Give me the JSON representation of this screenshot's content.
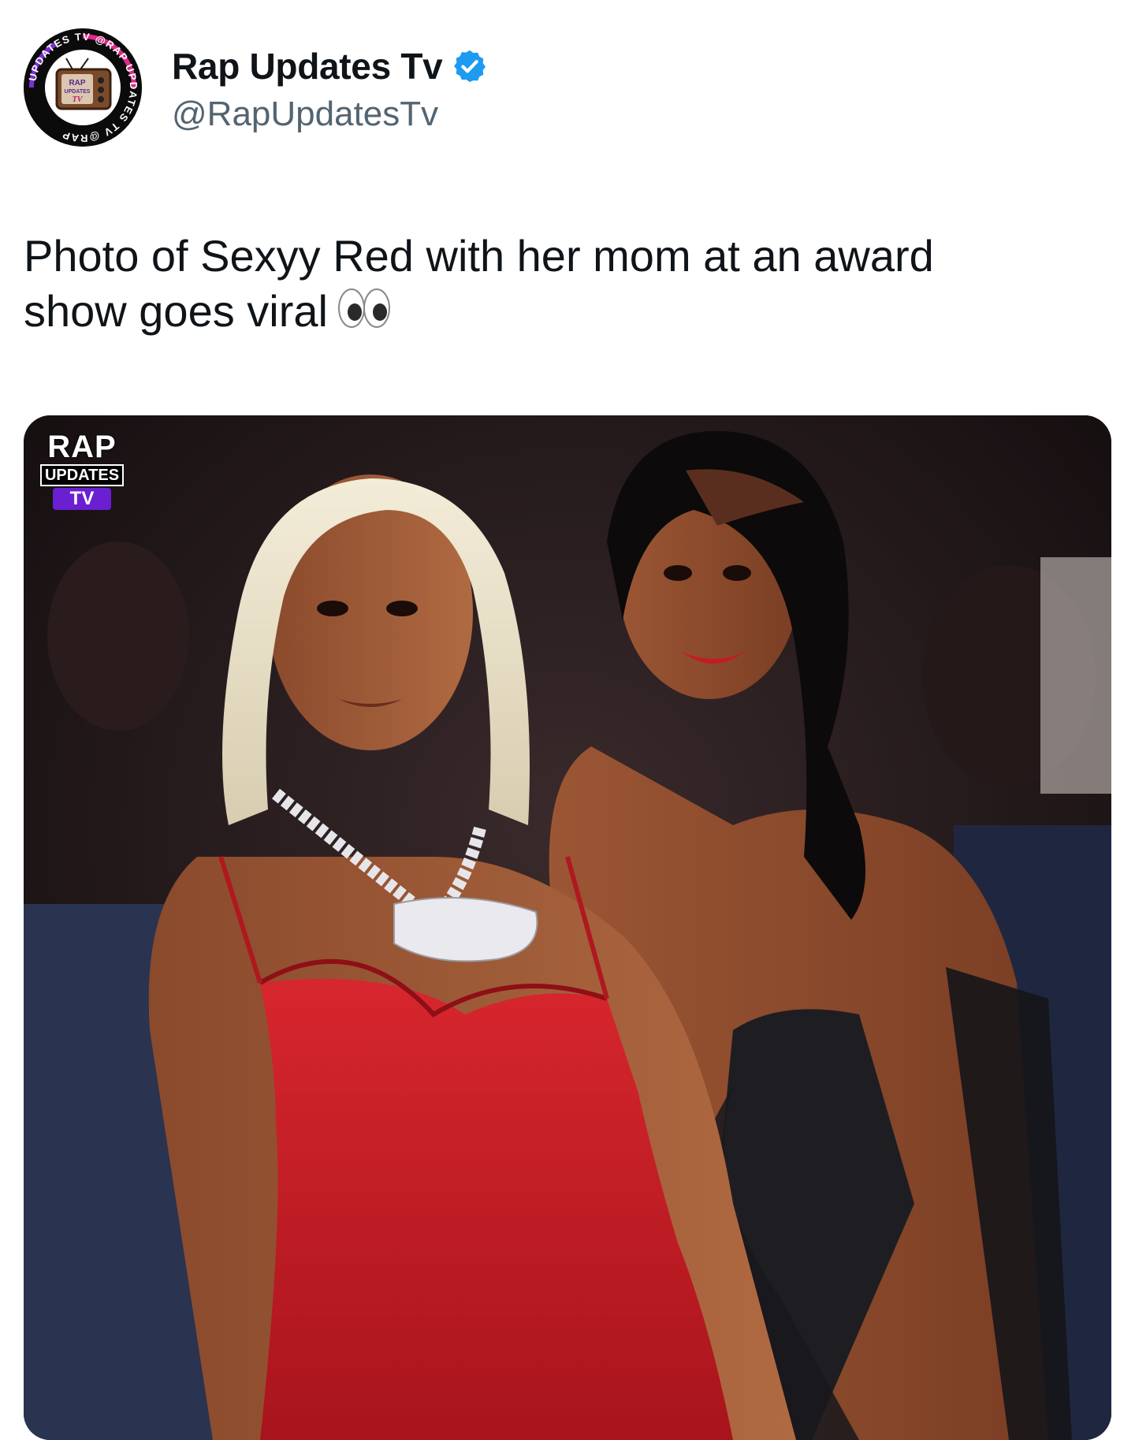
{
  "tweet": {
    "author": {
      "name": "Rap Updates Tv",
      "handle": "@RapUpdatesTv",
      "verified": true,
      "avatar_icon": "rap-updates-tv-logo",
      "avatar_ring_text": "UPDATES TV @RAP UPDATES TV @RAP",
      "avatar_center_text": [
        "RAP",
        "UPDATES",
        "TV"
      ]
    },
    "text_lines": [
      "Photo of Sexyy Red with her mom at an award",
      "show goes viral"
    ],
    "emoji": "eyes-emoji",
    "media": {
      "watermark": {
        "rap": "RAP",
        "updates": "UPDATES",
        "tv": "TV"
      }
    }
  },
  "colors": {
    "verified_blue": "#1d9bf0",
    "handle_gray": "#536471",
    "text_primary": "#0f1419",
    "watermark_purple": "#6a1fd1",
    "dress_red": "#c21c24"
  }
}
